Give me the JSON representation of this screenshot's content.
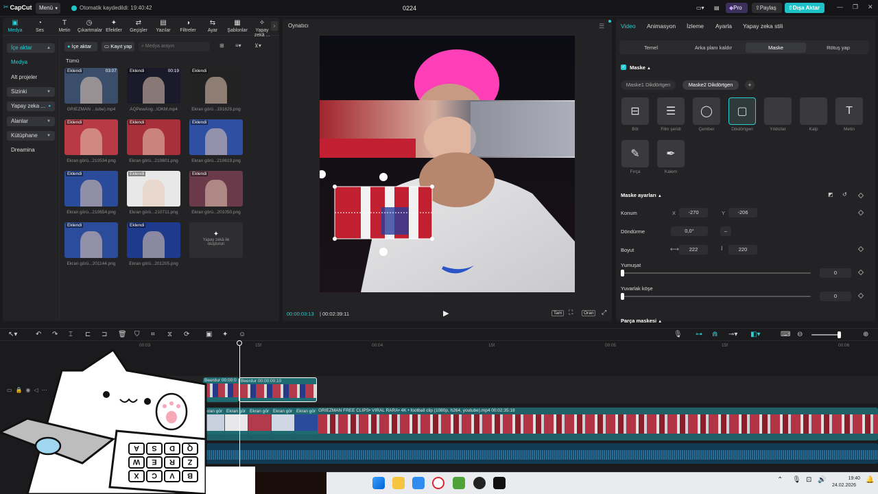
{
  "app": {
    "logo": "CapCut",
    "menu": "Menü",
    "autosave": "Otomatik kaydedildi: 19:40:42",
    "project_title": "0224",
    "pro": "Pro",
    "share": "Paylaş",
    "export": "Dışa Aktar"
  },
  "toolbar": [
    "Medya",
    "Ses",
    "Metin",
    "Çıkartmalar",
    "Efektler",
    "Geçişler",
    "Yazılar",
    "Filtreler",
    "Ayar",
    "Şablonlar",
    "Yapay zekâ ..."
  ],
  "sidebar": [
    {
      "label": "İçe aktar"
    },
    {
      "label": "Medya"
    },
    {
      "label": "Alt projeler"
    },
    {
      "label": "Sizinki"
    },
    {
      "label": "Yapay zeka ..."
    },
    {
      "label": "Alanlar"
    },
    {
      "label": "Kütüphane"
    },
    {
      "label": "Dreamina"
    }
  ],
  "media": {
    "import_btn": "İçe aktar",
    "record_btn": "Kayıt yap",
    "search_placeholder": "Medya arayın",
    "all_label": "Tümü",
    "added_badge": "Eklendi",
    "items": [
      {
        "name": "GRIEZMAN ...tube).mp4",
        "duration": "03:07"
      },
      {
        "name": "AQPewAng...lOKM.mp4",
        "duration": "00:19"
      },
      {
        "name": "Ekran görü...191829.png",
        "duration": ""
      },
      {
        "name": "Ekran görü...210534.png",
        "duration": ""
      },
      {
        "name": "Ekran görü...210601.png",
        "duration": ""
      },
      {
        "name": "Ekran görü...210619.png",
        "duration": ""
      },
      {
        "name": "Ekran görü...210654.png",
        "duration": ""
      },
      {
        "name": "Ekran görü...210711.png",
        "duration": ""
      },
      {
        "name": "Ekran görü...201050.png",
        "duration": ""
      },
      {
        "name": "Ekran görü...201144.png",
        "duration": ""
      },
      {
        "name": "Ekran görü...201205.png",
        "duration": ""
      }
    ],
    "ai_create": "Yapay zekâ ile oluşturun"
  },
  "player": {
    "title": "Oynatıcı",
    "current_time": "00:00:03:13",
    "total_time": "00:02:39:11",
    "full_btn": "Tam",
    "ratio_btn": "Oran"
  },
  "inspector": {
    "tabs": [
      "Video",
      "Animasyon",
      "İzleme",
      "Ayarla",
      "Yapay zeka stili"
    ],
    "subtabs": [
      "Temel",
      "Arka planı kaldır",
      "Maske",
      "Rötuş yap"
    ],
    "mask_title": "Maske",
    "mask_chips": [
      "Maske1 Dikdörtgen",
      "Maske2 Dikdörtgen"
    ],
    "shapes": [
      "Böl",
      "Film şeridi",
      "Çember",
      "Dikdörtgen",
      "Yıldızlar",
      "Kalp",
      "Metin",
      "Fırça",
      "Kalem"
    ],
    "mask_settings": "Maske ayarları",
    "position_label": "Konum",
    "pos_x_label": "X",
    "pos_x": "-270",
    "pos_y_label": "Y",
    "pos_y": "-206",
    "rotation_label": "Döndürme",
    "rotation": "0,0°",
    "size_label": "Boyut",
    "width": "222",
    "height": "220",
    "feather_label": "Yumuşat",
    "feather": "0",
    "round_label": "Yuvarlak köşe",
    "round": "0",
    "part_mask": "Parça maskesi"
  },
  "timeline": {
    "ruler": [
      "00:03",
      "15f",
      "00:04",
      "15f",
      "00:05",
      "15f",
      "00:06"
    ],
    "clip1_label": "Beerdur",
    "clip1_time": "00:00:0",
    "clip2_label": "Beerdur",
    "clip2_time": "00:00:00:10",
    "main_clips": [
      "Ekran gör",
      "Ekran gör",
      "Ekran gör",
      "Ekran gör",
      "Ekran gör"
    ],
    "main_video": "GRIEZMAN FREE CLIPS• VIRAL RARA• 4K • football clip (1080p, h264, youtube).mp4",
    "main_video_time": "00:02:35:18",
    "playhead_pct": 0.272
  },
  "keyboard_keys": [
    "A",
    "S",
    "D",
    "Q",
    "W",
    "E",
    "R",
    "Z",
    "X",
    "C",
    "V",
    "B"
  ],
  "taskbar": {
    "time": "19:40",
    "date": "24.02.2026"
  },
  "colors": {
    "accent": "#27cfd5",
    "export": "#1ec2c6",
    "track_teal": "#1f6b72",
    "bg": "#1b1b1d"
  }
}
